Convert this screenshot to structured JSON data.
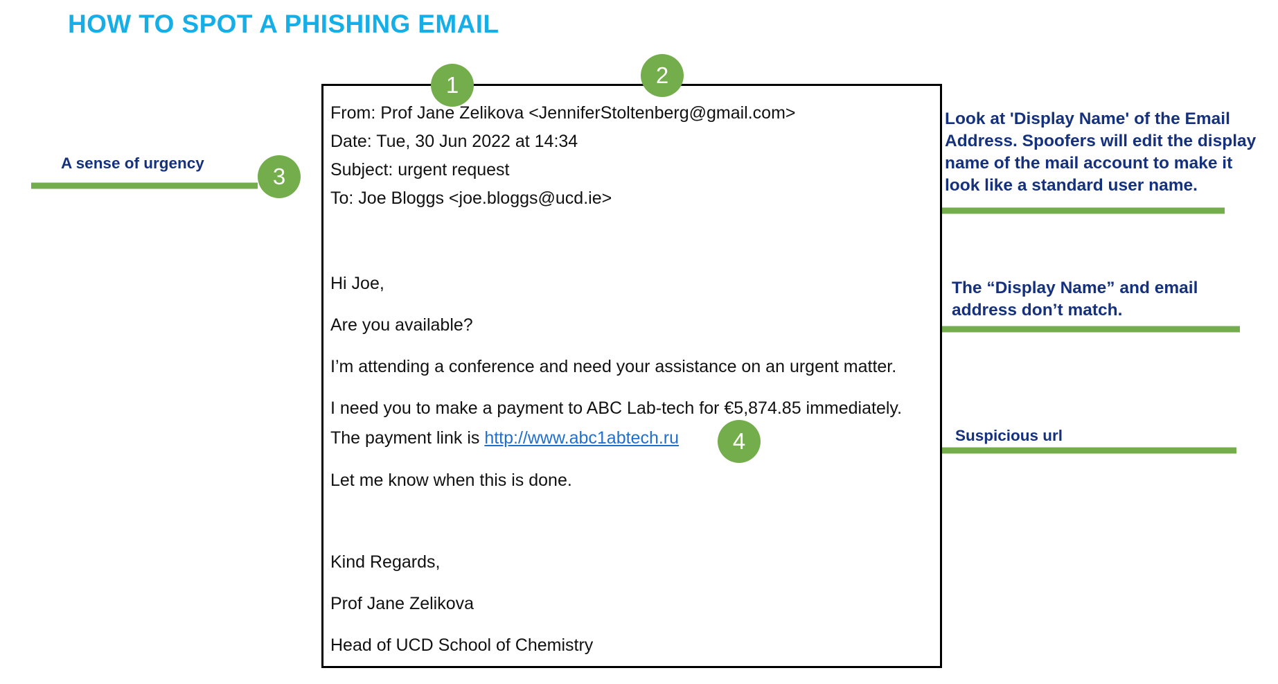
{
  "page": {
    "title": "HOW TO SPOT A PHISHING EMAIL",
    "title_color": "#15AEE6",
    "accent_green": "#74AD4C",
    "annotation_color": "#15317E",
    "link_color": "#1F6FD0"
  },
  "email": {
    "from": "From: Prof Jane Zelikova <JenniferStoltenberg@gmail.com>",
    "date": "Date: Tue, 30 Jun 2022 at 14:34",
    "subject": "Subject: urgent request",
    "to": "To: Joe Bloggs <joe.bloggs@ucd.ie>",
    "greeting": "Hi Joe,",
    "line_available": "Are you available?",
    "line_conference": "I’m attending a conference and need your assistance on an urgent matter.",
    "line_payment": " I need you to make a payment to ABC Lab-tech for €5,874.85 immediately.",
    "line_link_prefix": "The payment link is ",
    "link_text": "http://www.abc1abtech.ru",
    "line_letmeknow": "Let me know when this is done.",
    "signoff": "Kind Regards,",
    "signature_name": "Prof Jane Zelikova",
    "signature_title": "Head of UCD School of Chemistry"
  },
  "badges": [
    {
      "number": "1"
    },
    {
      "number": "2"
    },
    {
      "number": "3"
    },
    {
      "number": "4"
    }
  ],
  "annotations": {
    "one": "Look at 'Display Name' of the Email Address. Spoofers will edit the display name of the mail account to make it look like a standard user name.",
    "two": "The “Display Name” and email address don’t match.",
    "three": "A sense of urgency",
    "four": "Suspicious url"
  }
}
